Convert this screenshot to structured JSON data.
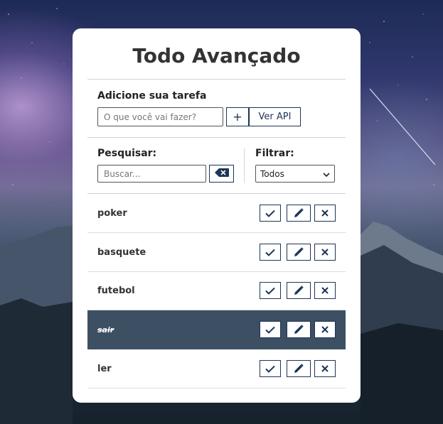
{
  "app": {
    "title": "Todo Avançado"
  },
  "add_section": {
    "label": "Adicione sua tarefa",
    "input_placeholder": "O que você vai fazer?",
    "add_button_label": "+",
    "api_button_label": "Ver API"
  },
  "search_section": {
    "label": "Pesquisar:",
    "input_placeholder": "Buscar...",
    "clear_icon": "backspace-icon"
  },
  "filter_section": {
    "label": "Filtrar:",
    "selected_option": "Todos",
    "chevron_icon": "chevron-down-icon"
  },
  "todos": [
    {
      "text": "poker",
      "done": false
    },
    {
      "text": "basquete",
      "done": false
    },
    {
      "text": "futebol",
      "done": false
    },
    {
      "text": "sair",
      "done": true
    },
    {
      "text": "ler",
      "done": false
    }
  ],
  "todo_actions": {
    "finish_icon": "check-icon",
    "edit_icon": "pencil-icon",
    "remove_icon": "close-icon"
  },
  "colors": {
    "accent": "#1d3557",
    "done_background": "#3d4f63",
    "card_background": "#ffffff"
  }
}
